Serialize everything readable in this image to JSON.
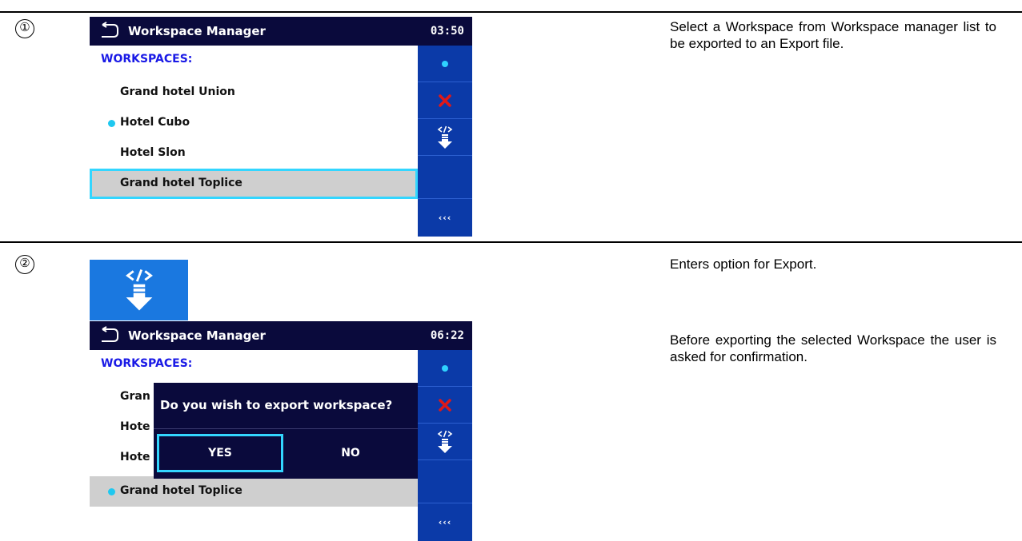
{
  "steps": [
    {
      "number": "①",
      "description": "Select a Workspace from Workspace manager list to be exported to an Export file.",
      "screen": {
        "title": "Workspace Manager",
        "time": "03:50",
        "heading": "WORKSPACES:",
        "items": [
          "Grand hotel Union",
          "Hotel Cubo",
          "Hotel Slon",
          "Grand hotel Toplice"
        ]
      }
    },
    {
      "number": "②",
      "description_export": "Enters option for Export.",
      "description_confirm": "Before exporting the selected Workspace the user is asked for confirmation.",
      "screen": {
        "title": "Workspace Manager",
        "time": "06:22",
        "heading": "WORKSPACES:",
        "items_partial": [
          "Gran",
          "Hote",
          "Hote"
        ],
        "selected_item": "Grand hotel Toplice",
        "dialog": {
          "question": "Do you wish to export workspace?",
          "yes": "YES",
          "no": "NO"
        }
      }
    }
  ],
  "sidebar": {
    "more_label": "‹‹‹"
  },
  "colors": {
    "titlebar": "#0a0a3c",
    "sidebar": "#0b3aa8",
    "accent_cyan": "#33d6ff",
    "heading_blue": "#1a1ae6",
    "selection_gray": "#cfcfcf",
    "delete_red": "#e01818"
  },
  "icons": [
    "back-icon",
    "status-dot-icon",
    "delete-icon",
    "export-icon",
    "more-icon"
  ]
}
